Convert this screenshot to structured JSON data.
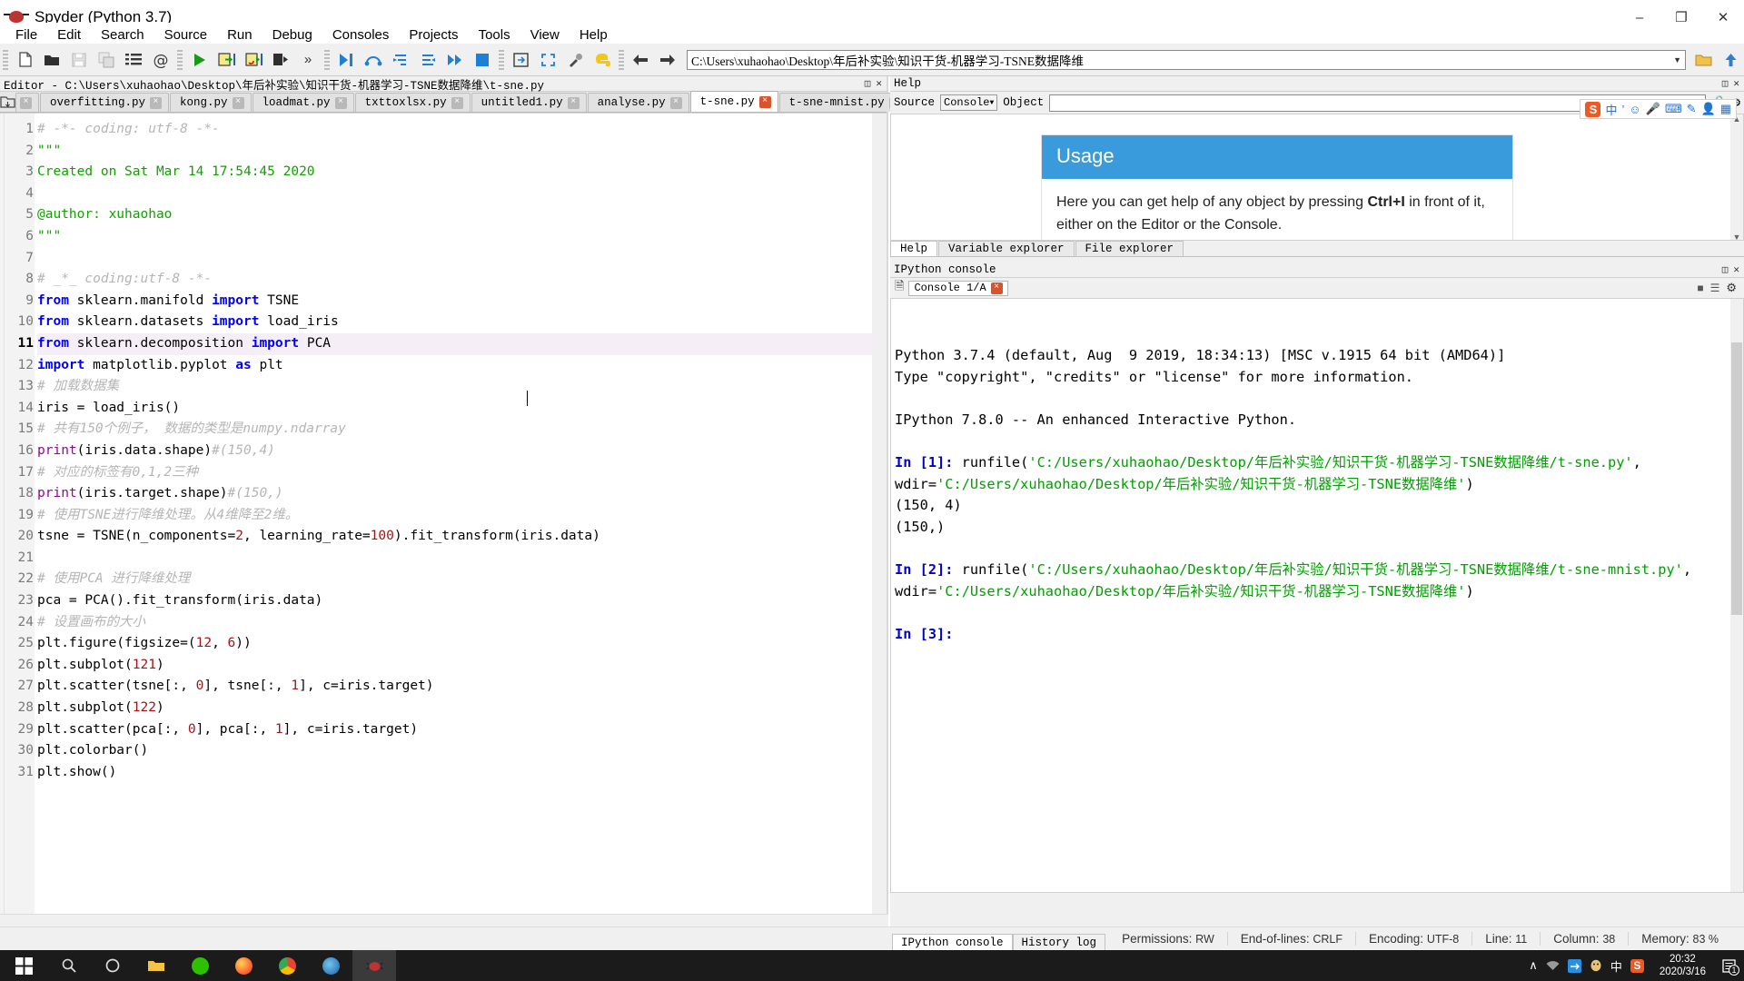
{
  "window": {
    "title": "Spyder (Python 3.7)",
    "app_icon": "spider-icon",
    "minimize": "–",
    "maximize": "❐",
    "close": "✕"
  },
  "menubar": {
    "items": [
      "File",
      "Edit",
      "Search",
      "Source",
      "Run",
      "Debug",
      "Consoles",
      "Projects",
      "Tools",
      "View",
      "Help"
    ]
  },
  "toolbar": {
    "path_value": "C:\\Users\\xuhaohao\\Desktop\\年后补实验\\知识干货-机器学习-TSNE数据降维",
    "overflow_label": "»",
    "icons": [
      "new-file-icon",
      "open-file-icon",
      "save-file-icon",
      "save-all-icon",
      "file-switcher-icon",
      "find-symbol-icon",
      "run-file-icon",
      "run-cell-icon",
      "run-cell-advance-icon",
      "run-selection-icon",
      "debug-file-icon",
      "debug-step-over-icon",
      "debug-step-into-icon",
      "debug-step-return-icon",
      "debug-continue-icon",
      "debug-stop-icon",
      "maximize-pane-icon",
      "fullscreen-icon",
      "preferences-icon",
      "pythonpath-icon",
      "back-icon",
      "forward-icon"
    ]
  },
  "editor": {
    "panel_title": "Editor - C:\\Users\\xuhaohao\\Desktop\\年后补实验\\知识干货-机器学习-TSNE数据降维\\t-sne.py",
    "browse_tabs_icon": "browse-tabs-icon",
    "close_pane_icon": "close-icon",
    "undock_icon": "undock-icon",
    "tabs": [
      {
        "label": "overfitting.py",
        "active": false
      },
      {
        "label": "kong.py",
        "active": false
      },
      {
        "label": "loadmat.py",
        "active": false
      },
      {
        "label": "txttoxlsx.py",
        "active": false
      },
      {
        "label": "untitled1.py",
        "active": false
      },
      {
        "label": "analyse.py",
        "active": false
      },
      {
        "label": "t-sne.py",
        "active": true
      },
      {
        "label": "t-sne-mnist.py",
        "active": false
      }
    ],
    "tab_close_glyph": "×",
    "nav_prev": "◀",
    "nav_next": "▶",
    "options_icon": "gear-icon",
    "current_line": 11,
    "lines": [
      {
        "n": 1,
        "segs": [
          {
            "t": "# -*- coding: utf-8 -*-",
            "c": "cmt"
          }
        ]
      },
      {
        "n": 2,
        "segs": [
          {
            "t": "\"\"\"",
            "c": "str"
          }
        ]
      },
      {
        "n": 3,
        "segs": [
          {
            "t": "Created on Sat Mar 14 17:54:45 2020",
            "c": "str"
          }
        ]
      },
      {
        "n": 4,
        "segs": [
          {
            "t": "",
            "c": "str"
          }
        ]
      },
      {
        "n": 5,
        "segs": [
          {
            "t": "@author: xuhaohao",
            "c": "str"
          }
        ]
      },
      {
        "n": 6,
        "segs": [
          {
            "t": "\"\"\"",
            "c": "str"
          }
        ]
      },
      {
        "n": 7,
        "segs": [
          {
            "t": "",
            "c": ""
          }
        ]
      },
      {
        "n": 8,
        "segs": [
          {
            "t": "# _*_ coding:utf-8 -*-",
            "c": "cmt"
          }
        ]
      },
      {
        "n": 9,
        "segs": [
          {
            "t": "from",
            "c": "kw"
          },
          {
            "t": " sklearn.manifold ",
            "c": ""
          },
          {
            "t": "import",
            "c": "kw"
          },
          {
            "t": " TSNE",
            "c": ""
          }
        ]
      },
      {
        "n": 10,
        "segs": [
          {
            "t": "from",
            "c": "kw"
          },
          {
            "t": " sklearn.datasets ",
            "c": ""
          },
          {
            "t": "import",
            "c": "kw"
          },
          {
            "t": " load_iris",
            "c": ""
          }
        ]
      },
      {
        "n": 11,
        "segs": [
          {
            "t": "from",
            "c": "kw"
          },
          {
            "t": " sklearn.decomposition ",
            "c": ""
          },
          {
            "t": "import",
            "c": "kw"
          },
          {
            "t": " PCA",
            "c": ""
          }
        ]
      },
      {
        "n": 12,
        "segs": [
          {
            "t": "import",
            "c": "kw"
          },
          {
            "t": " matplotlib.pyplot ",
            "c": ""
          },
          {
            "t": "as",
            "c": "kw"
          },
          {
            "t": " plt",
            "c": ""
          }
        ]
      },
      {
        "n": 13,
        "segs": [
          {
            "t": "# 加载数据集",
            "c": "cmt"
          }
        ]
      },
      {
        "n": 14,
        "segs": [
          {
            "t": "iris = load_iris()",
            "c": ""
          }
        ]
      },
      {
        "n": 15,
        "segs": [
          {
            "t": "# 共有150个例子， 数据的类型是numpy.ndarray",
            "c": "cmt"
          }
        ]
      },
      {
        "n": 16,
        "segs": [
          {
            "t": "print",
            "c": "bi"
          },
          {
            "t": "(iris.data.shape)",
            "c": ""
          },
          {
            "t": "#(150,4)",
            "c": "cmt"
          }
        ]
      },
      {
        "n": 17,
        "segs": [
          {
            "t": "# 对应的标签有0,1,2三种",
            "c": "cmt"
          }
        ]
      },
      {
        "n": 18,
        "segs": [
          {
            "t": "print",
            "c": "bi"
          },
          {
            "t": "(iris.target.shape)",
            "c": ""
          },
          {
            "t": "#(150,)",
            "c": "cmt"
          }
        ]
      },
      {
        "n": 19,
        "segs": [
          {
            "t": "# 使用TSNE进行降维处理。从4维降至2维。",
            "c": "cmt"
          }
        ]
      },
      {
        "n": 20,
        "segs": [
          {
            "t": "tsne = TSNE(n_components=",
            "c": ""
          },
          {
            "t": "2",
            "c": "num"
          },
          {
            "t": ", learning_rate=",
            "c": ""
          },
          {
            "t": "100",
            "c": "num"
          },
          {
            "t": ").fit_transform(iris.data)",
            "c": ""
          }
        ]
      },
      {
        "n": 21,
        "segs": [
          {
            "t": "",
            "c": ""
          }
        ]
      },
      {
        "n": 22,
        "segs": [
          {
            "t": "# 使用PCA 进行降维处理",
            "c": "cmt"
          }
        ]
      },
      {
        "n": 23,
        "segs": [
          {
            "t": "pca = PCA().fit_transform(iris.data)",
            "c": ""
          }
        ]
      },
      {
        "n": 24,
        "segs": [
          {
            "t": "# 设置画布的大小",
            "c": "cmt"
          }
        ]
      },
      {
        "n": 25,
        "segs": [
          {
            "t": "plt.figure(figsize=(",
            "c": ""
          },
          {
            "t": "12",
            "c": "num"
          },
          {
            "t": ", ",
            "c": ""
          },
          {
            "t": "6",
            "c": "num"
          },
          {
            "t": "))",
            "c": ""
          }
        ]
      },
      {
        "n": 26,
        "segs": [
          {
            "t": "plt.subplot(",
            "c": ""
          },
          {
            "t": "121",
            "c": "num"
          },
          {
            "t": ")",
            "c": ""
          }
        ]
      },
      {
        "n": 27,
        "segs": [
          {
            "t": "plt.scatter(tsne[:, ",
            "c": ""
          },
          {
            "t": "0",
            "c": "num"
          },
          {
            "t": "], tsne[:, ",
            "c": ""
          },
          {
            "t": "1",
            "c": "num"
          },
          {
            "t": "], c=iris.target)",
            "c": ""
          }
        ]
      },
      {
        "n": 28,
        "segs": [
          {
            "t": "plt.subplot(",
            "c": ""
          },
          {
            "t": "122",
            "c": "num"
          },
          {
            "t": ")",
            "c": ""
          }
        ]
      },
      {
        "n": 29,
        "segs": [
          {
            "t": "plt.scatter(pca[:, ",
            "c": ""
          },
          {
            "t": "0",
            "c": "num"
          },
          {
            "t": "], pca[:, ",
            "c": ""
          },
          {
            "t": "1",
            "c": "num"
          },
          {
            "t": "], c=iris.target)",
            "c": ""
          }
        ]
      },
      {
        "n": 30,
        "segs": [
          {
            "t": "plt.colorbar()",
            "c": ""
          }
        ]
      },
      {
        "n": 31,
        "segs": [
          {
            "t": "plt.show()",
            "c": ""
          }
        ]
      }
    ]
  },
  "help": {
    "panel_title": "Help",
    "undock_icon": "undock-icon",
    "close_icon": "close-icon",
    "source_label": "Source",
    "source_value": "Console",
    "object_label": "Object",
    "object_value": "",
    "lock_icon": "lock-icon",
    "options_icon": "gear-icon",
    "usage_title": "Usage",
    "usage_text_1": "Here you can get help of any object by pressing ",
    "usage_shortcut": "Ctrl+I",
    "usage_text_2": " in front of it, either on the Editor or the Console.",
    "usage_header_color": "#3a9bdc",
    "tabs": [
      {
        "label": "Help",
        "active": true
      },
      {
        "label": "Variable explorer",
        "active": false
      },
      {
        "label": "File explorer",
        "active": false
      }
    ],
    "ime": {
      "brand": "S",
      "items": [
        "中",
        "゛",
        "☺",
        "⬤",
        "⌨",
        "⌸",
        "♟",
        "▓"
      ],
      "brand_color": "#ef5a22"
    }
  },
  "console": {
    "panel_title": "IPython console",
    "undock_icon": "undock-icon",
    "close_icon": "close-icon",
    "new_console_icon": "new-console-icon",
    "tab_label": "Console 1/A",
    "tab_close_glyph": "×",
    "stop_icon": "stop-icon",
    "menu_icon": "hamburger-icon",
    "options_icon": "gear-icon",
    "lines": [
      [
        {
          "t": "Python 3.7.4 (default, Aug  9 2019, 18:34:13) [MSC v.1915 64 bit (AMD64)]",
          "c": ""
        }
      ],
      [
        {
          "t": "Type \"copyright\", \"credits\" or \"license\" for more information.",
          "c": ""
        }
      ],
      [
        {
          "t": "",
          "c": ""
        }
      ],
      [
        {
          "t": "IPython 7.8.0 -- An enhanced Interactive Python.",
          "c": ""
        }
      ],
      [
        {
          "t": "",
          "c": ""
        }
      ],
      [
        {
          "t": "In [1]:",
          "c": "cin"
        },
        {
          "t": " runfile(",
          "c": ""
        },
        {
          "t": "'C:/Users/xuhaohao/Desktop/年后补实验/知识干货-机器学习-TSNE数据降维/t-sne.py'",
          "c": "cpath"
        },
        {
          "t": ", wdir=",
          "c": ""
        },
        {
          "t": "'C:/Users/xuhaohao/Desktop/年后补实验/知识干货-机器学习-TSNE数据降维'",
          "c": "cpath"
        },
        {
          "t": ")",
          "c": ""
        }
      ],
      [
        {
          "t": "(150, 4)",
          "c": ""
        }
      ],
      [
        {
          "t": "(150,)",
          "c": ""
        }
      ],
      [
        {
          "t": "",
          "c": ""
        }
      ],
      [
        {
          "t": "In [2]:",
          "c": "cin"
        },
        {
          "t": " runfile(",
          "c": ""
        },
        {
          "t": "'C:/Users/xuhaohao/Desktop/年后补实验/知识干货-机器学习-TSNE数据降维/t-sne-mnist.py'",
          "c": "cpath"
        },
        {
          "t": ", wdir=",
          "c": ""
        },
        {
          "t": "'C:/Users/xuhaohao/Desktop/年后补实验/知识干货-机器学习-TSNE数据降维'",
          "c": "cpath"
        },
        {
          "t": ")",
          "c": ""
        }
      ],
      [
        {
          "t": "",
          "c": ""
        }
      ],
      [
        {
          "t": "In [3]:",
          "c": "cin"
        }
      ]
    ],
    "bottom_tabs": [
      {
        "label": "IPython console",
        "active": true
      },
      {
        "label": "History log",
        "active": false
      }
    ]
  },
  "statusbar": {
    "permissions_label": "Permissions:",
    "permissions_value": "RW",
    "eol_label": "End-of-lines:",
    "eol_value": "CRLF",
    "encoding_label": "Encoding:",
    "encoding_value": "UTF-8",
    "line_label": "Line:",
    "line_value": "11",
    "column_label": "Column:",
    "column_value": "38",
    "memory_label": "Memory:",
    "memory_value": "83 %"
  },
  "taskbar": {
    "start_icon": "windows-start-icon",
    "search_icon": "search-icon",
    "cortana_icon": "cortana-icon",
    "apps": [
      {
        "name": "file-explorer-icon",
        "color": "#f6c445"
      },
      {
        "name": "wechat-icon",
        "color": "#2dc100"
      },
      {
        "name": "firefox-icon",
        "color": "#ff7139"
      },
      {
        "name": "chrome-icon",
        "color": "#4285f4"
      },
      {
        "name": "edge-icon",
        "color": "#3277bc"
      },
      {
        "name": "spyder-icon",
        "color": "#b33"
      }
    ],
    "tray_expand": "∧",
    "tray_items": [
      "network-icon",
      "onedrive-icon",
      "qq-icon",
      "ime-icon",
      "sogou-icon"
    ],
    "time": "20:32",
    "date": "2020/3/16",
    "notification_icon": "notification-icon",
    "notification_count": "1"
  }
}
